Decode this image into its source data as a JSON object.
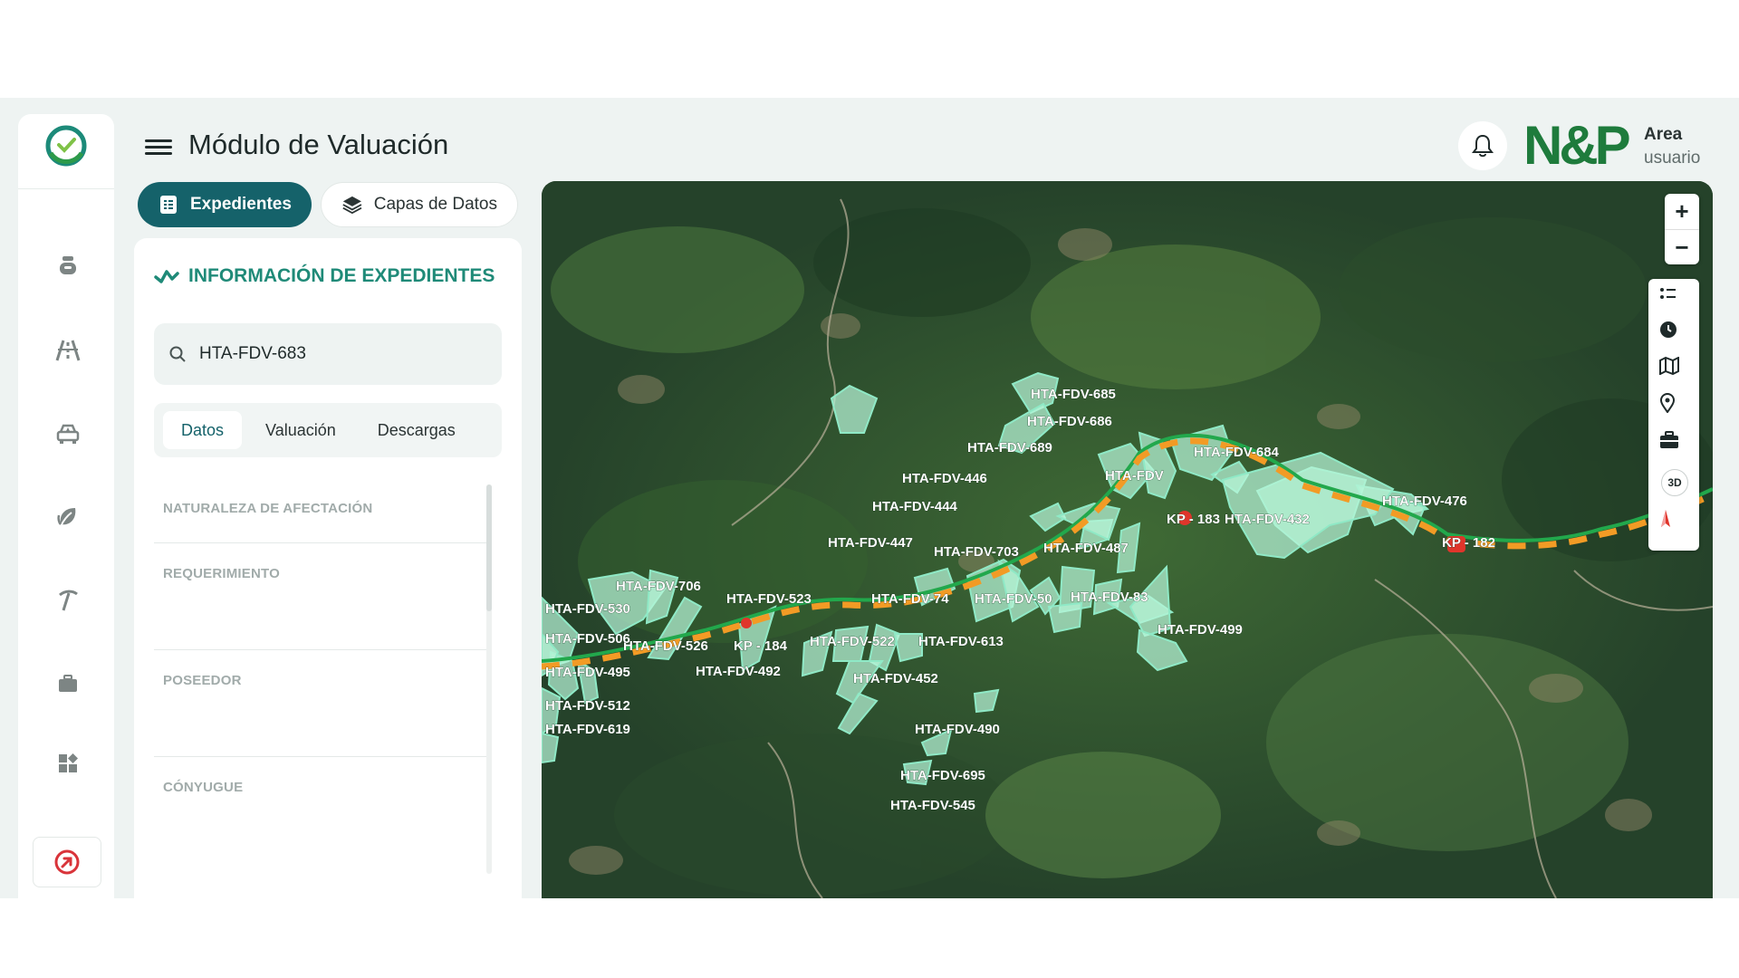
{
  "header": {
    "title": "Módulo de Valuación",
    "brand": "N&P",
    "user_line1": "Area",
    "user_line2": "usuario"
  },
  "tabs": [
    {
      "label": "Expedientes",
      "icon": "file-list-icon",
      "active": true
    },
    {
      "label": "Capas de Datos",
      "icon": "layers-icon",
      "active": false
    }
  ],
  "panel": {
    "title": "INFORMACIÓN DE EXPEDIENTES",
    "search_value": "HTA-FDV-683",
    "subtabs": [
      "Datos",
      "Valuación",
      "Descargas"
    ],
    "active_subtab": "Datos",
    "fields": [
      "NATURALEZA DE AFECTACIÓN",
      "REQUERIMIENTO",
      "POSEEDOR",
      "CÓNYUGUE"
    ]
  },
  "sidebar": {
    "icons": [
      "money-bag-icon",
      "road-icon",
      "vehicle-icon",
      "leaf-icon",
      "pickaxe-icon",
      "briefcase-icon",
      "dashboard-icon"
    ],
    "logout_icon": "logout-icon"
  },
  "map": {
    "labels": [
      "HTA-FDV-685",
      "HTA-FDV-686",
      "HTA-FDV-689",
      "HTA-FDV-684",
      "HTA-FDV-446",
      "HTA-FDV-444",
      "HTA-FDV-447",
      "HTA-FDV-703",
      "HTA-FDV-487",
      "HTA-FDV-432",
      "HTA-FDV-476",
      "HTA-FDV-706",
      "HTA-FDV-523",
      "HTA-FDV-526",
      "HTA-FDV-492",
      "HTA-FDV-522",
      "HTA-FDV-613",
      "HTA-FDV-452",
      "HTA-FDV-499",
      "HTA-FDV-490",
      "HTA-FDV-695",
      "HTA-FDV-545",
      "HTA-FDV-530",
      "HTA-FDV-619",
      "HTA-FDV-512",
      "HTA-FDV-495",
      "HTA-FDV-506",
      "HTA-FDV-74",
      "HTA-FDV-50",
      "HTA-FDV-83",
      "HTA-FDV"
    ],
    "kp_markers": [
      "KP - 182",
      "KP - 183",
      "KP - 184"
    ],
    "tools": [
      "legend-icon",
      "clock-icon",
      "map-icon",
      "pin-icon",
      "toolbox-icon",
      "3D",
      "compass-icon"
    ],
    "colors": {
      "parcel_fill": "#b7f5d8",
      "parcel_stroke": "#8fe9c6",
      "route_green": "#22a84c",
      "route_orange": "#f29b25",
      "kp_red": "#e0352b"
    }
  }
}
